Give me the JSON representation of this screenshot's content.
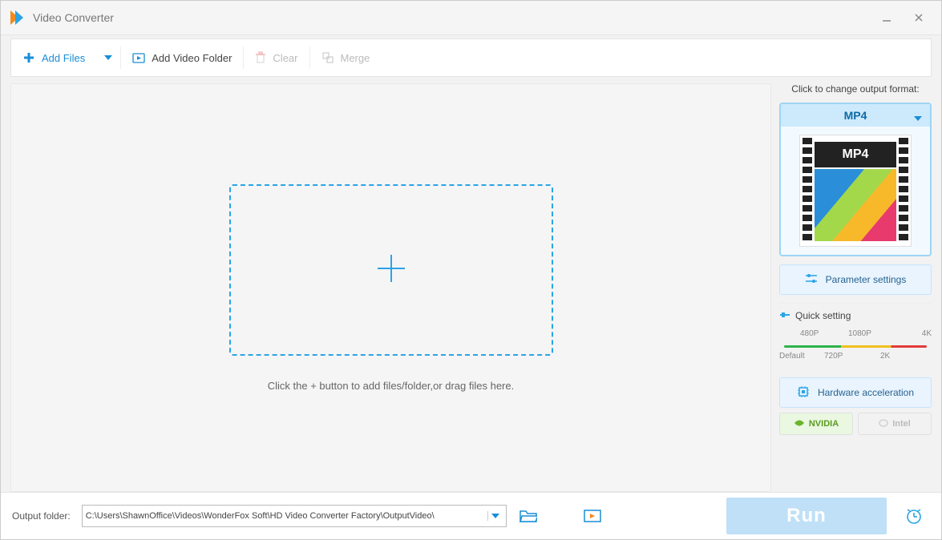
{
  "title": "Video Converter",
  "toolbar": {
    "add_files": "Add Files",
    "add_folder": "Add Video Folder",
    "clear": "Clear",
    "merge": "Merge"
  },
  "drop": {
    "hint": "Click the + button to add files/folder,or drag files here."
  },
  "side": {
    "change_label": "Click to change output format:",
    "format_name": "MP4",
    "format_badge": "MP4",
    "param_btn": "Parameter settings",
    "quick_title": "Quick setting",
    "scale": {
      "p480": "480P",
      "p1080": "1080P",
      "p4k": "4K",
      "default": "Default",
      "p720": "720P",
      "p2k": "2K"
    },
    "hw_btn": "Hardware acceleration",
    "nvidia": "NVIDIA",
    "intel": "Intel"
  },
  "footer": {
    "label": "Output folder:",
    "path": "C:\\Users\\ShawnOffice\\Videos\\WonderFox Soft\\HD Video Converter Factory\\OutputVideo\\",
    "run": "Run"
  }
}
